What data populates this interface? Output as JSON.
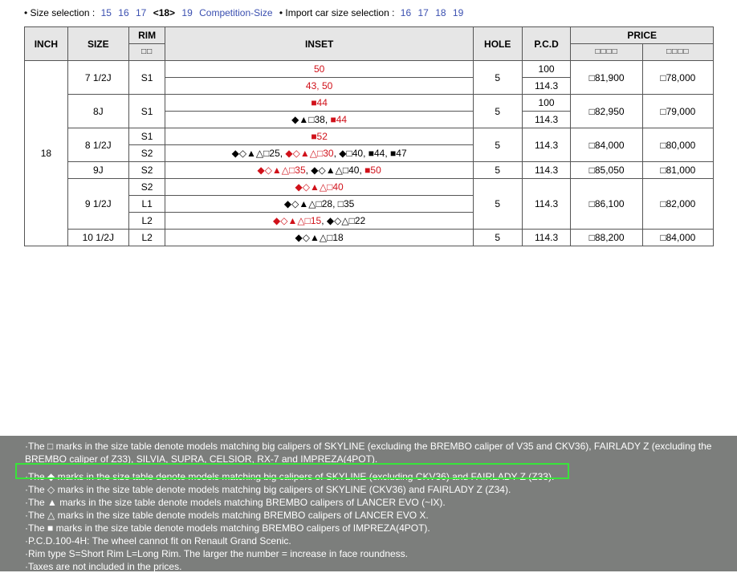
{
  "size_selection": {
    "prefix": "• Size selection :",
    "links": [
      "15",
      "16",
      "17"
    ],
    "current": "<18>",
    "after": [
      "19",
      "Competition-Size"
    ]
  },
  "import_selection": {
    "prefix": "• Import car size selection :",
    "links": [
      "16",
      "17",
      "18",
      "19"
    ]
  },
  "table": {
    "headers": {
      "inch": "INCH",
      "size": "SIZE",
      "rim": "RIM",
      "rim_sub": "□□",
      "inset": "INSET",
      "hole": "HOLE",
      "pcd": "P.C.D",
      "price": "PRICE",
      "price_sub1": "□□□□",
      "price_sub2": "□□□□"
    },
    "inch": "18",
    "groups": [
      {
        "size": "7 1/2J",
        "hole": "5",
        "price1": "□81,900",
        "price2": "□78,000",
        "rows": [
          {
            "rim": "S1",
            "inset": "<span class=\"r\">50</span>",
            "pcd": "100"
          },
          {
            "inset": "<span class=\"r\">43, 50</span>",
            "pcd": "114.3"
          }
        ]
      },
      {
        "size": "8J",
        "hole": "5",
        "price1": "□82,950",
        "price2": "□79,000",
        "rows": [
          {
            "rim": "S1",
            "inset": "<span class=\"r\">■44</span>",
            "pcd": "100"
          },
          {
            "inset": "◆▲□38, <span class=\"r\">■44</span>",
            "pcd": "114.3"
          }
        ]
      },
      {
        "size": "8 1/2J",
        "hole": "5",
        "pcd": "114.3",
        "price1": "□84,000",
        "price2": "□80,000",
        "rows": [
          {
            "rim": "S1",
            "inset": "<span class=\"r\">■52</span>"
          },
          {
            "rim": "S2",
            "inset": "◆◇▲△□25, <span class=\"r\">◆◇▲△□30</span>, ◆□40, ■44, ■47"
          }
        ]
      },
      {
        "size": "9J",
        "hole": "5",
        "pcd": "114.3",
        "price1": "□85,050",
        "price2": "□81,000",
        "rows": [
          {
            "rim": "S2",
            "inset": "<span class=\"r\">◆◇▲△□35</span>, ◆◇▲△□40, <span class=\"r\">■50</span>"
          }
        ]
      },
      {
        "size": "9 1/2J",
        "hole": "5",
        "pcd": "114.3",
        "price1": "□86,100",
        "price2": "□82,000",
        "rows": [
          {
            "rim": "S2",
            "inset": "<span class=\"r\">◆◇▲△□40</span>"
          },
          {
            "rim": "L1",
            "inset": "◆◇▲△□28, □35"
          },
          {
            "rim": "L2",
            "inset": "<span class=\"r\">◆◇▲△□15</span>, ◆◇△□22"
          }
        ]
      },
      {
        "size": "10 1/2J",
        "hole": "5",
        "pcd": "114.3",
        "price1": "□88,200",
        "price2": "□84,000",
        "rows": [
          {
            "rim": "L2",
            "inset": "◆◇▲△□18"
          }
        ]
      }
    ]
  },
  "notes": [
    "·The □ marks in the size table denote models matching big calipers of SKYLINE (excluding the BREMBO caliper of V35 and CKV36), FAIRLADY Z (excluding the BREMBO caliper of Z33), SILVIA, SUPRA, CELSIOR, RX-7 and IMPREZA(4POT).",
    "·The ◆ marks in the size table denote models matching big calipers of SKYLINE (excluding CKV36) and FAIRLADY Z (Z33).",
    "·The ◇ marks in the size table denote models matching big calipers of SKYLINE (CKV36) and FAIRLADY Z (Z34).",
    "·The ▲ marks in the size table denote models matching BREMBO calipers of LANCER EVO (~IX).",
    "·The △ marks in the size table denote models matching BREMBO calipers of LANCER EVO X.",
    "·The ■ marks in the size table denote models matching BREMBO calipers of IMPREZA(4POT).",
    "·P.C.D.100-4H: The wheel cannot fit on Renault Grand Scenic.",
    "·Rim type S=Short Rim L=Long Rim. The larger the number = increase in face roundness.",
    "·Taxes are not included in the prices."
  ],
  "colors": {
    "accent_link": "#3a4fb0",
    "mark_red": "#d0111a",
    "highlight": "#38e43a",
    "notes_bg": "#7c7e7c"
  }
}
